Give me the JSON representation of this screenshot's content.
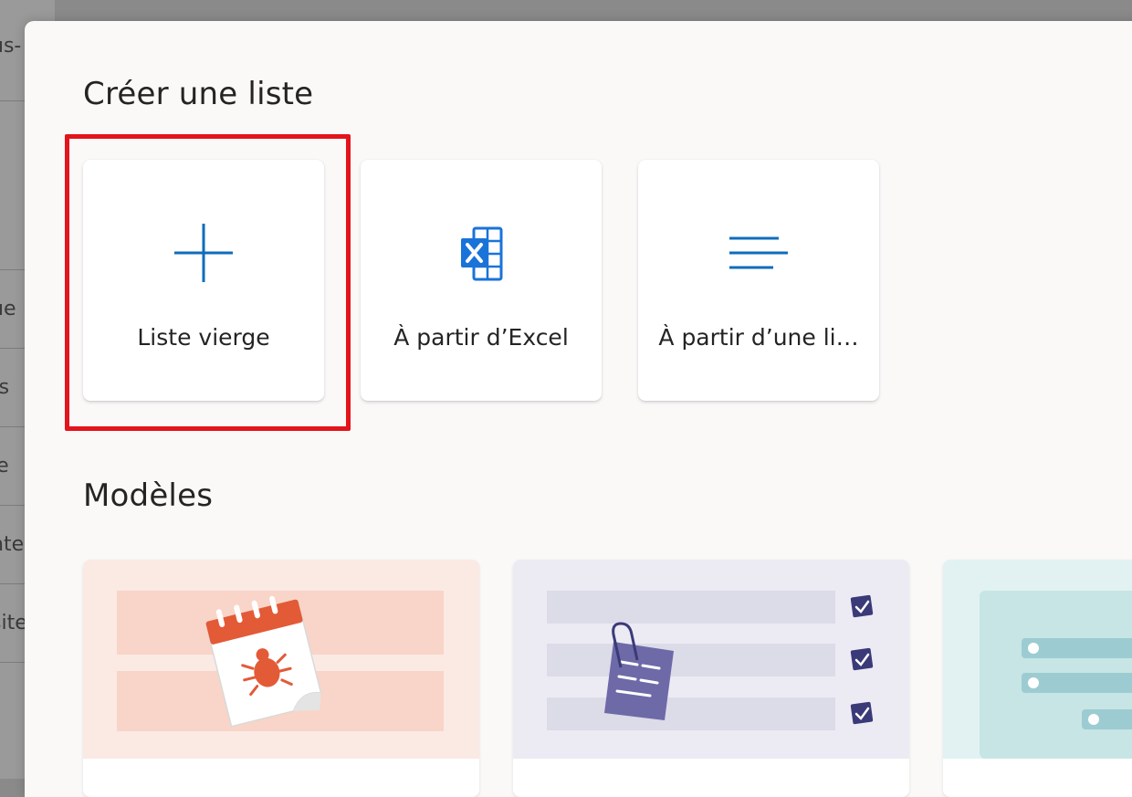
{
  "background": {
    "fragments": [
      "us-",
      "ue",
      "ts",
      "le",
      "nte",
      "site"
    ]
  },
  "dialog": {
    "create_title": "Créer une liste",
    "options": [
      {
        "label": "Liste vierge",
        "icon": "plus-icon"
      },
      {
        "label": "À partir d’Excel",
        "icon": "excel-icon"
      },
      {
        "label": "À partir d’une li…",
        "icon": "lines-icon"
      }
    ],
    "templates_title": "Modèles",
    "colors": {
      "accent": "#0f6cbd",
      "excel_blue": "#1a73d9",
      "highlight": "#e3141b"
    }
  }
}
